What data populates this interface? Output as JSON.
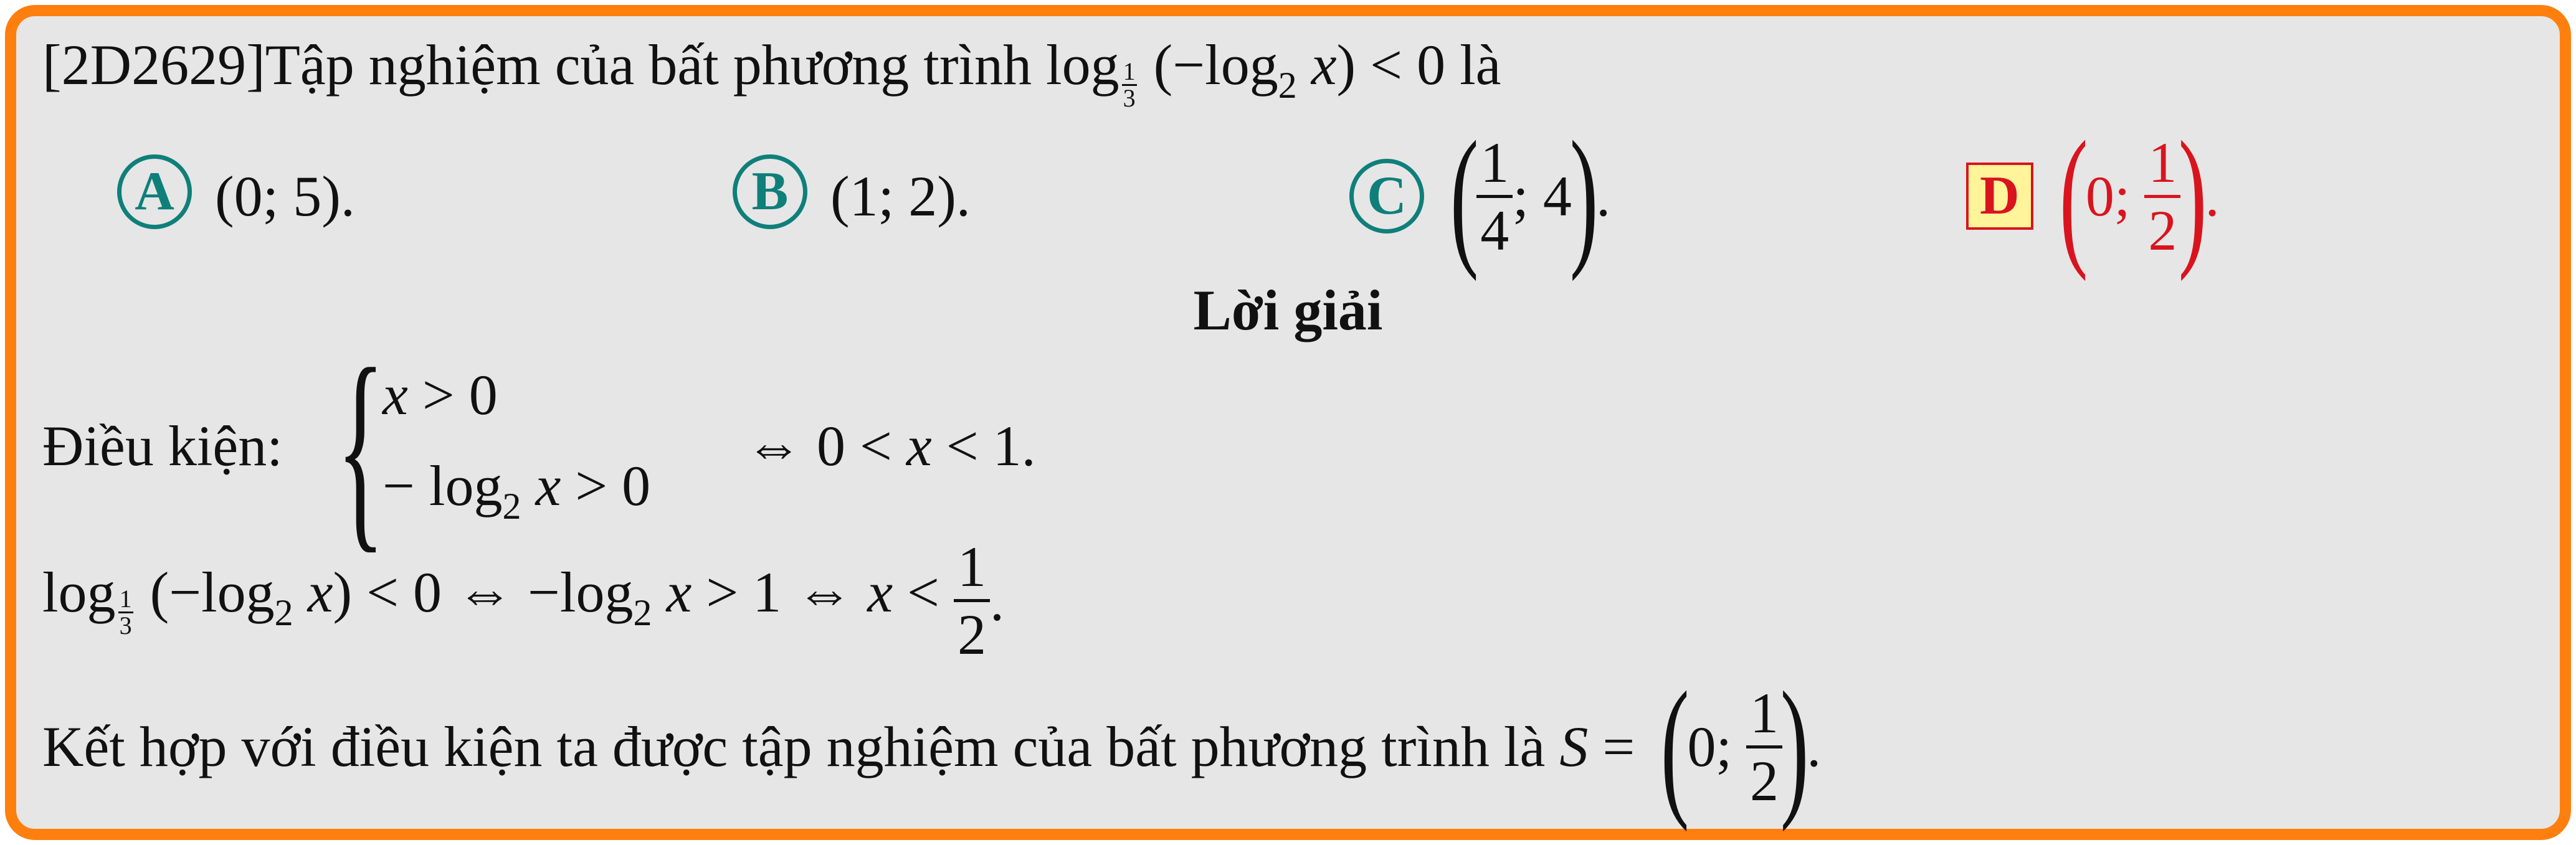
{
  "question": {
    "id": "[2D2629]",
    "text_before": "Tập nghiệm của bất phương trình ",
    "text_after": " là"
  },
  "options": [
    {
      "letter": "A",
      "text": "(0; 5)."
    },
    {
      "letter": "B",
      "text": "(1; 2)."
    },
    {
      "letter": "C",
      "num": "1",
      "den": "4",
      "rest": "; 4",
      "end": "."
    },
    {
      "letter": "D",
      "prefix": "0; ",
      "num": "1",
      "den": "2",
      "end": "."
    }
  ],
  "solution": {
    "heading": "Lời giải",
    "condition_label": "Điều kiện:",
    "conclusion_text": "Kết hợp với điều kiện ta được tập nghiệm của bất phương trình là "
  },
  "colors": {
    "border": "#ff7f0e",
    "option_circle": "#0f7f7a",
    "answer_red": "#d9141e",
    "answer_box": "#fff49a",
    "card_bg": "#e6e6e6"
  }
}
